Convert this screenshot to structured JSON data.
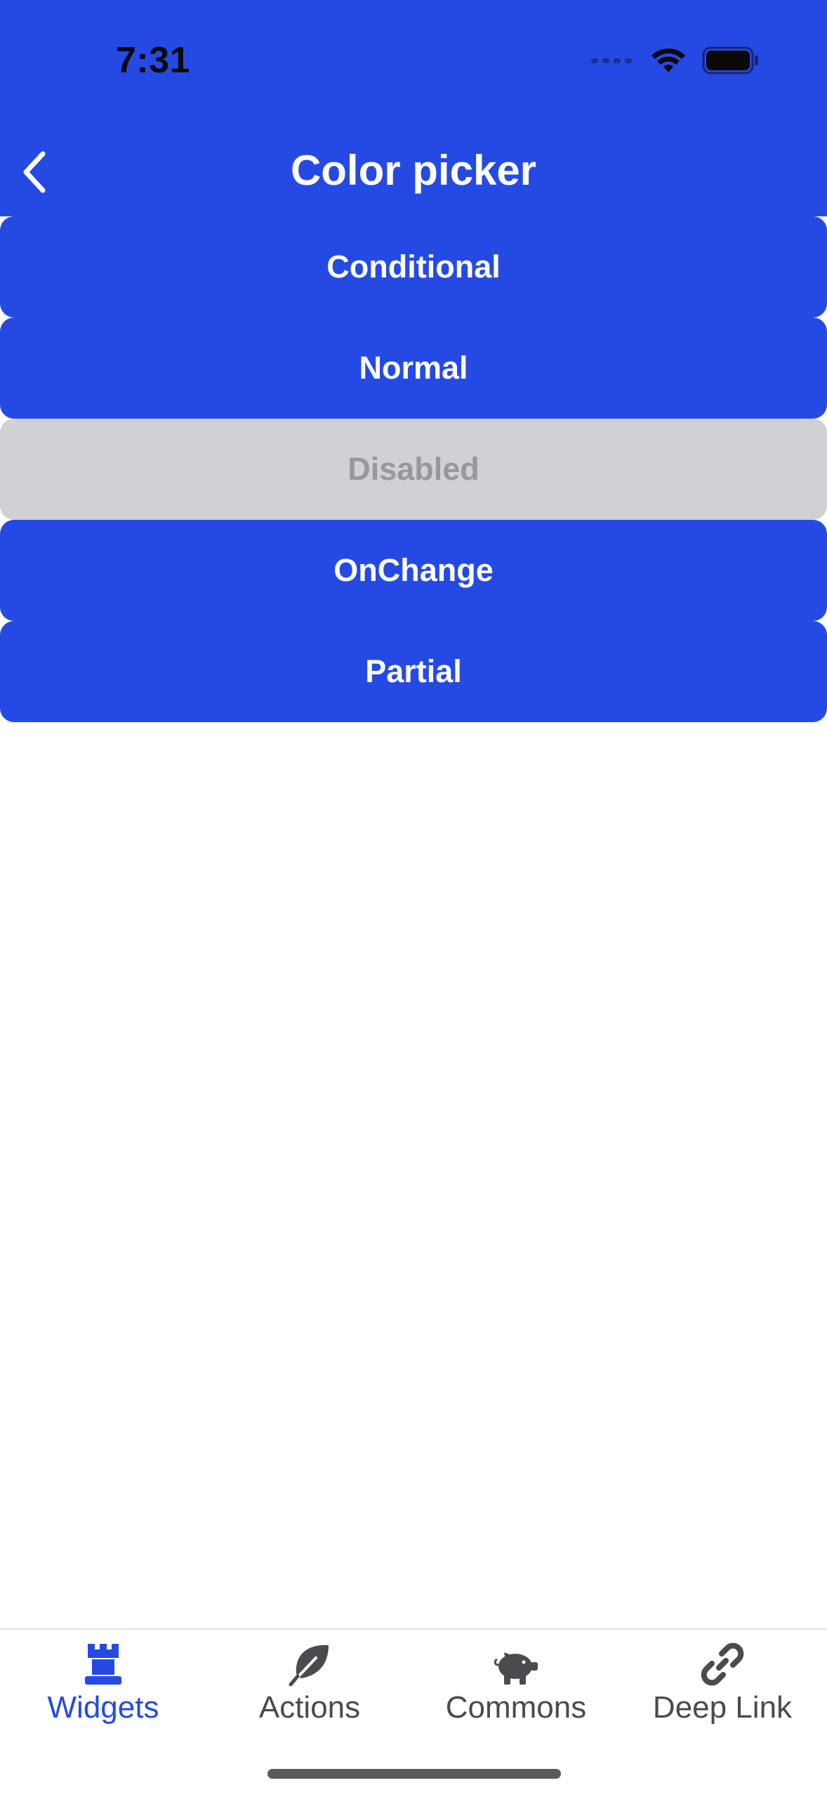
{
  "status_bar": {
    "time": "7:31"
  },
  "nav": {
    "title": "Color picker",
    "back_icon": "chevron-left-icon"
  },
  "buttons": [
    {
      "label": "Conditional",
      "enabled": true
    },
    {
      "label": "Normal",
      "enabled": true
    },
    {
      "label": "Disabled",
      "enabled": false
    },
    {
      "label": "OnChange",
      "enabled": true
    },
    {
      "label": "Partial",
      "enabled": true
    }
  ],
  "tabs": [
    {
      "label": "Widgets",
      "icon": "rook-icon",
      "active": true
    },
    {
      "label": "Actions",
      "icon": "leaf-icon",
      "active": false
    },
    {
      "label": "Commons",
      "icon": "piggy-bank-icon",
      "active": false
    },
    {
      "label": "Deep Link",
      "icon": "link-icon",
      "active": false
    }
  ],
  "colors": {
    "accent": "#254ae4",
    "disabled_bg": "#d0d1d4",
    "disabled_text": "#97989c",
    "tab_inactive": "#4a4a4f"
  }
}
